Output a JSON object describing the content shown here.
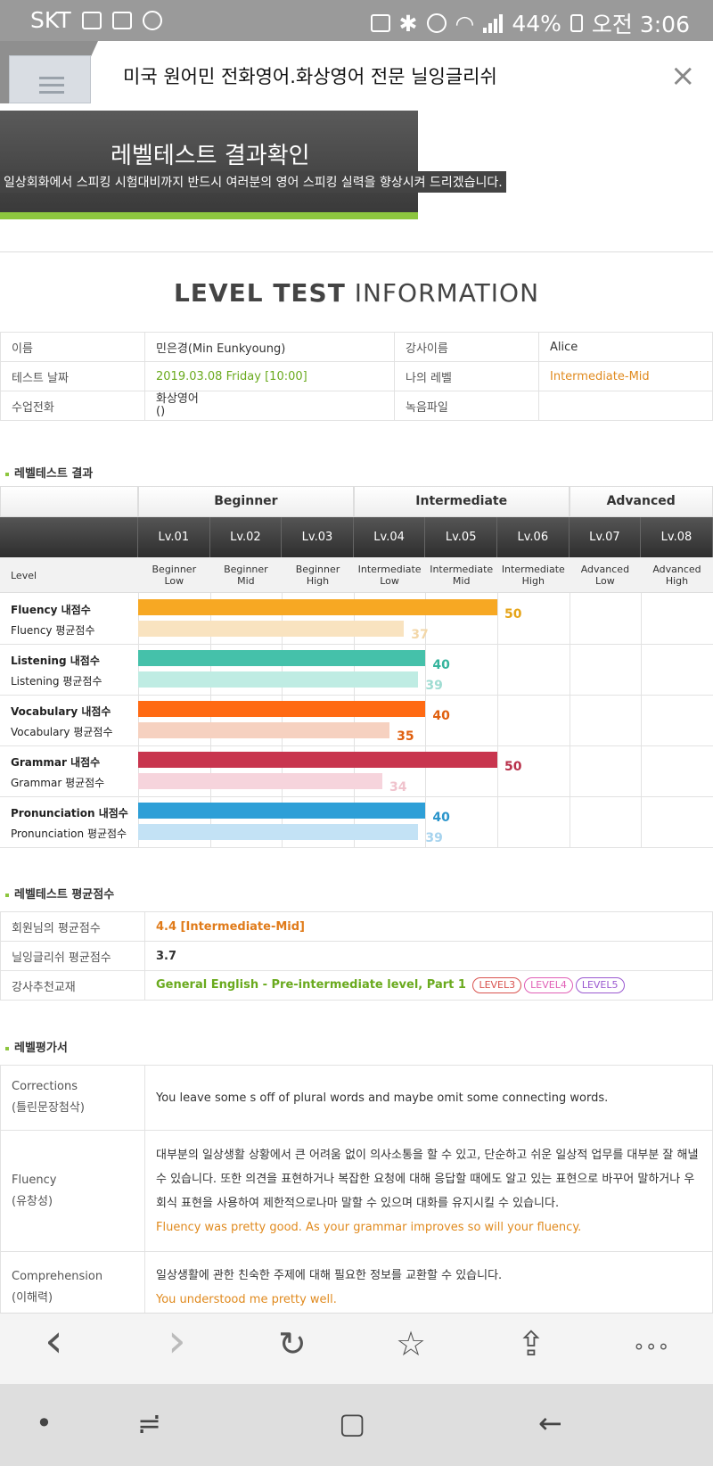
{
  "status": {
    "carrier": "SKT",
    "battery": "44%",
    "time": "오전 3:06"
  },
  "browser": {
    "title": "미국 원어민 전화영어.화상영어 전문 닐잉글리쉬",
    "close": "×"
  },
  "banner": {
    "title": "레벨테스트 결과확인",
    "subtitle": "일상회화에서 스피킹 시험대비까지 반드시 여러분의 영어 스피킹 실력을 향상시켜 드리겠습니다."
  },
  "info": {
    "heading_bold": "LEVEL TEST",
    "heading_light": " INFORMATION",
    "rows": [
      {
        "l1": "이름",
        "v1": "민은경(Min Eunkyoung)",
        "l2": "강사이름",
        "v2": "Alice"
      },
      {
        "l1": "테스트 날짜",
        "v1": "2019.03.08  Friday [10:00]",
        "l2": "나의 레벨",
        "v2": "Intermediate-Mid"
      },
      {
        "l1": "수업전화",
        "v1a": "화상영어",
        "v1b": "()",
        "l2": "녹음파일",
        "v2": ""
      }
    ]
  },
  "results": {
    "heading": "레벨테스트 결과",
    "groups": [
      "Beginner",
      "Intermediate",
      "Advanced"
    ],
    "levels": [
      "Lv.01",
      "Lv.02",
      "Lv.03",
      "Lv.04",
      "Lv.05",
      "Lv.06",
      "Lv.07",
      "Lv.08"
    ],
    "level_label": "Level",
    "sublevels": [
      [
        "Beginner",
        "Low"
      ],
      [
        "Beginner",
        "Mid"
      ],
      [
        "Beginner",
        "High"
      ],
      [
        "Intermediate",
        "Low"
      ],
      [
        "Intermediate",
        "Mid"
      ],
      [
        "Intermediate",
        "High"
      ],
      [
        "Advanced",
        "Low"
      ],
      [
        "Advanced",
        "High"
      ]
    ],
    "rows": [
      {
        "main_label": "Fluency 내점수",
        "avg_label": "Fluency 평균점수",
        "mine": 50,
        "avg": 37,
        "color": "#f7a823",
        "avg_color": "#f9e3c0",
        "val_color": "#e5a418",
        "avg_val_color": "#f3d7a8"
      },
      {
        "main_label": "Listening 내점수",
        "avg_label": "Listening 평균점수",
        "mine": 40,
        "avg": 39,
        "color": "#45c1aa",
        "avg_color": "#bfece3",
        "val_color": "#35b49d",
        "avg_val_color": "#9fdcd2"
      },
      {
        "main_label": "Vocabulary 내점수",
        "avg_label": "Vocabulary 평균점수",
        "mine": 40,
        "avg": 35,
        "color": "#ff6a13",
        "avg_color": "#f6d1c0",
        "val_color": "#e0600f",
        "avg_val_color": "#e0600f"
      },
      {
        "main_label": "Grammar 내점수",
        "avg_label": "Grammar 평균점수",
        "mine": 50,
        "avg": 34,
        "color": "#c8354e",
        "avg_color": "#f6d4dc",
        "val_color": "#b8304a",
        "avg_val_color": "#f0c3cd"
      },
      {
        "main_label": "Pronunciation 내점수",
        "avg_label": "Pronunciation 평균점수",
        "mine": 40,
        "avg": 39,
        "color": "#2e9fd7",
        "avg_color": "#c3e2f5",
        "val_color": "#2b95cb",
        "avg_val_color": "#a6d3ee"
      }
    ],
    "max_score": 80
  },
  "avg_score": {
    "heading": "레벨테스트 평균점수",
    "rows": [
      {
        "label": "회원님의 평균점수",
        "value": "4.4 [Intermediate-Mid]"
      },
      {
        "label": "닐잉글리쉬 평균점수",
        "value": "3.7"
      },
      {
        "label": "강사추천교재",
        "value": "General English - Pre-intermediate level, Part 1"
      }
    ],
    "pills": [
      {
        "text": "LEVEL3",
        "color": "#d9534f"
      },
      {
        "text": "LEVEL4",
        "color": "#e05fb6"
      },
      {
        "text": "LEVEL5",
        "color": "#9b59d0"
      }
    ]
  },
  "evaluation": {
    "heading": "레벨평가서",
    "rows": [
      {
        "label1": "Corrections",
        "label2": "(틀린문장첨삭)",
        "ko": "You leave some s off of plural words and maybe omit some connecting words.",
        "en": ""
      },
      {
        "label1": "Fluency",
        "label2": "(유창성)",
        "ko": "대부분의 일상생활 상황에서 큰 어려움 없이 의사소통을 할 수 있고, 단순하고 쉬운 일상적 업무를 대부분 잘 해낼 수 있습니다. 또한 의견을 표현하거나 복잡한 요청에 대해 응답할 때에도 알고 있는 표현으로 바꾸어 말하거나 우회식 표현을 사용하여 제한적으로나마 말할 수 있으며 대화를 유지시킬 수 있습니다.",
        "en": "Fluency was pretty good. As your grammar improves so will your fluency."
      },
      {
        "label1": "Comprehension",
        "label2": "(이해력)",
        "ko": "일상생활에 관한 친숙한 주제에 대해 필요한 정보를 교환할 수 있습니다.",
        "en": "You understood me pretty well."
      }
    ]
  },
  "nav": {
    "back": "‹",
    "forward": "›",
    "reload": "↻",
    "star": "☆",
    "share": "⇪",
    "more": "∘∘∘"
  },
  "system": {
    "dot": "•",
    "recent": "≓",
    "home": "▢",
    "back": "←"
  }
}
